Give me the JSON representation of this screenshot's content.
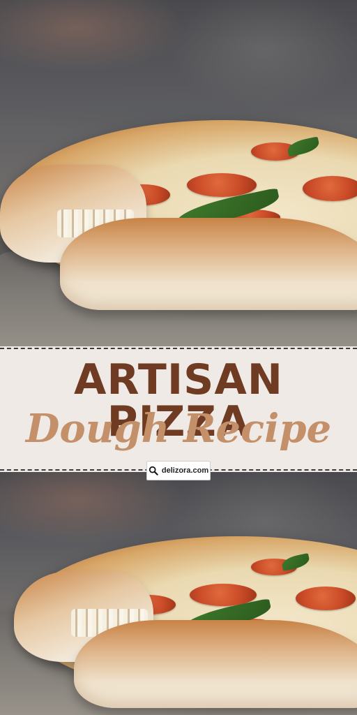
{
  "title": {
    "line1": "ARTISAN PIZZA",
    "line2": "Dough Recipe"
  },
  "site_badge": {
    "text": "delizora.com",
    "icon": "magnifier-icon"
  },
  "colors": {
    "title_primary": "#6f3b22",
    "title_script": "#c4906a",
    "banner_bg": "#efeae6"
  }
}
